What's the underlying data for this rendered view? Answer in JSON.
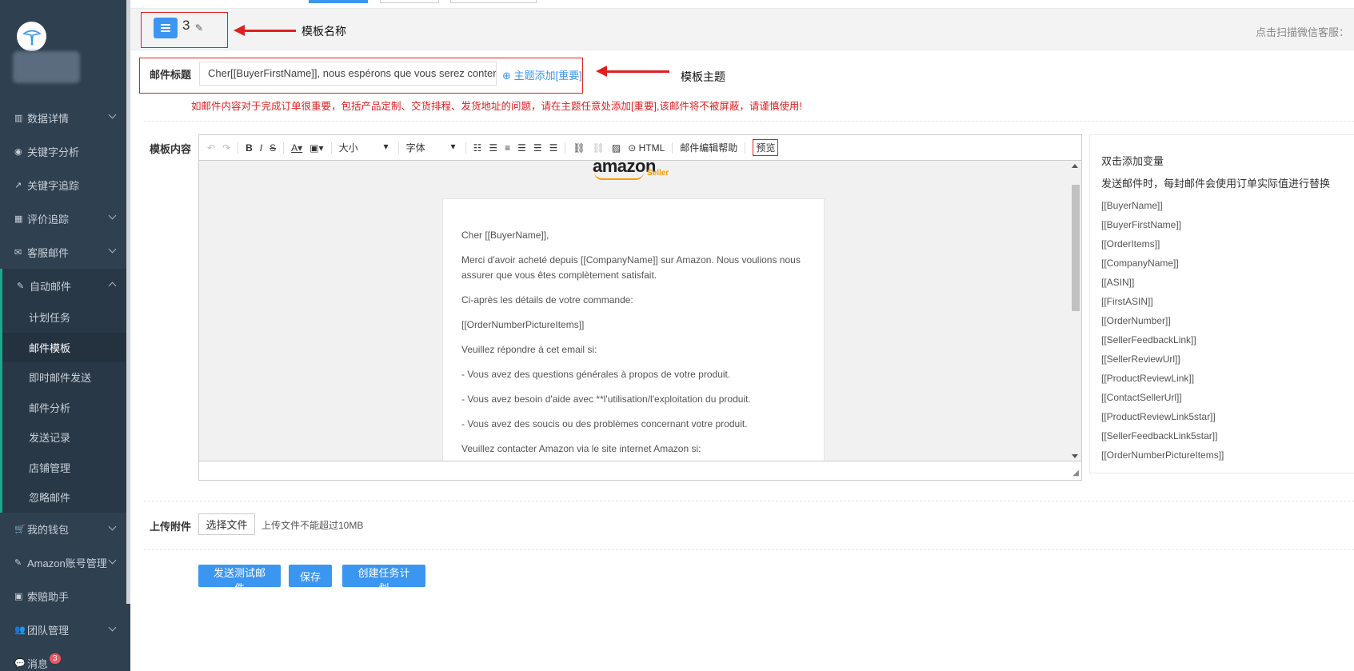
{
  "sidebar": {
    "items": [
      {
        "icon": "bar-chart-icon",
        "glyph": "▥",
        "label": "数据详情",
        "expandable": true
      },
      {
        "icon": "target-icon",
        "glyph": "◉",
        "label": "关键字分析",
        "expandable": false
      },
      {
        "icon": "line-chart-icon",
        "glyph": "↗",
        "label": "关键字追踪",
        "expandable": false
      },
      {
        "icon": "table-icon",
        "glyph": "▦",
        "label": "评价追踪",
        "expandable": true
      },
      {
        "icon": "envelope-icon",
        "glyph": "✉",
        "label": "客服邮件",
        "expandable": true
      },
      {
        "icon": "edit-icon",
        "glyph": "✎",
        "label": "自动邮件",
        "expandable": true
      }
    ],
    "auto_mail_sub": [
      "计划任务",
      "邮件模板",
      "即时邮件发送",
      "邮件分析",
      "发送记录",
      "店铺管理",
      "忽略邮件"
    ],
    "items_after": [
      {
        "icon": "cart-icon",
        "glyph": "🛒",
        "label": "我的钱包",
        "expandable": true
      },
      {
        "icon": "edit-icon",
        "glyph": "✎",
        "label": "Amazon账号管理",
        "expandable": true
      },
      {
        "icon": "claim-icon",
        "glyph": "▣",
        "label": "索赔助手",
        "expandable": false
      },
      {
        "icon": "team-icon",
        "glyph": "👥",
        "label": "团队管理",
        "expandable": true
      },
      {
        "icon": "message-icon",
        "glyph": "💬",
        "label": "消息",
        "expandable": false
      }
    ],
    "message_badge": "3"
  },
  "header": {
    "template_name": "3",
    "right_note": "点击扫描微信客服："
  },
  "annotations": {
    "template_name": "模板名称",
    "template_subject": "模板主题"
  },
  "subject": {
    "label": "邮件标题",
    "value": "Cher[[BuyerFirstName]], nous espérons que vous serez content",
    "add_link": "主题添加[重要]",
    "warning": "如邮件内容对于完成订单很重要，包括产品定制、交货排程、发货地址的问题，请在主题任意处添加[重要],该邮件将不被屏蔽，请谨慎使用!"
  },
  "editor": {
    "label": "模板内容",
    "toolbar": {
      "size": "大小",
      "font": "字体",
      "html": "HTML",
      "help": "邮件编辑帮助",
      "preview": "预览"
    },
    "logo_text": "amazon",
    "logo_sub": "Seller",
    "body": [
      "Cher [[BuyerName]],",
      "Merci d'avoir acheté depuis [[CompanyName]] sur Amazon. Nous voulions nous assurer que vous êtes complètement satisfait.",
      "Ci-après les détails de votre commande:",
      "[[OrderNumberPictureItems]]",
      "Veuillez répondre à cet email si:",
      "- Vous avez des questions générales à propos de votre produit.",
      "- Vous avez besoin d'aide avec **l'utilisation/l'exploitation du produit.",
      "- Vous avez des soucis ou des problèmes concernant votre produit.",
      "Veuillez contacter Amazon via le site internet Amazon si:"
    ]
  },
  "variables": {
    "title": "双击添加变量",
    "desc": "发送邮件时，每封邮件会使用订单实际值进行替换",
    "items": [
      "[[BuyerName]]",
      "[[BuyerFirstName]]",
      "[[OrderItems]]",
      "[[CompanyName]]",
      "[[ASIN]]",
      "[[FirstASIN]]",
      "[[OrderNumber]]",
      "[[SellerFeedbackLink]]",
      "[[SellerReviewUrl]]",
      "[[ProductReviewLink]]",
      "[[ContactSellerUrl]]",
      "[[ProductReviewLink5star]]",
      "[[SellerFeedbackLink5star]]",
      "[[OrderNumberPictureItems]]"
    ]
  },
  "upload": {
    "label": "上传附件",
    "button": "选择文件",
    "note": "上传文件不能超过10MB"
  },
  "actions": {
    "send_test": "发送测试邮件",
    "save": "保存",
    "create_task": "创建任务计划"
  },
  "colors": {
    "primary": "#3b96f1",
    "sidebar": "#2f4050",
    "warning": "#e02020"
  }
}
